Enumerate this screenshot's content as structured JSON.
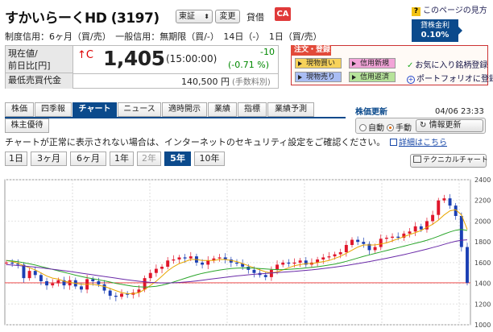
{
  "header": {
    "stock_title": "すかいらーくHD (3197)",
    "market": "東証",
    "change_label": "変更",
    "lending_label": "貸借",
    "ca_badge": "CA",
    "page_help": "このページの見方",
    "lending_rate_label": "貸株金利",
    "lending_rate_value": "0.10%",
    "credit_info": "制度信用：6ヶ月（買/売）　一般信用：無期限（買/-）　14日（-）　1日（買/売）"
  },
  "price": {
    "label_current": "現在値/",
    "label_prev": "前日比[円]",
    "label_turnover": "最低売買代金",
    "mark": "↑C",
    "value": "1,405",
    "time": "(15:00:00)",
    "change": "-10",
    "change_pct": "(-0.71 %)",
    "turnover": "140,500",
    "turnover_unit": "円",
    "fee_note": "(手数料別)",
    "color_down": "#008800"
  },
  "order": {
    "title": "注文・登録",
    "buy": "現物買い",
    "new_credit": "信用新規",
    "sell": "現物売り",
    "repay": "信用返済",
    "favorite": "お気に入り銘柄登録",
    "portfolio": "ポートフォリオに登録"
  },
  "tabs": [
    "株価",
    "四季報",
    "チャート",
    "ニュース",
    "適時開示",
    "業績",
    "指標",
    "業績予測"
  ],
  "tab_active": "チャート",
  "tab_row2": "株主優待",
  "update": {
    "title": "株価更新",
    "time": "04/06 23:33",
    "auto": "自動",
    "manual": "手動",
    "refresh": "情報更新"
  },
  "notice": "チャートが正常に表示されない場合は、インターネットのセキュリティ設定をご確認ください。",
  "details": "詳細はこちら",
  "periods": [
    "1日",
    "3ヶ月",
    "6ヶ月",
    "1年",
    "2年",
    "5年",
    "10年"
  ],
  "period_active": "5年",
  "period_disabled": "2年",
  "tech_chart": "テクニカルチャート",
  "chart_data": {
    "type": "line",
    "ylim": [
      1000,
      2400
    ],
    "y_ticks": [
      "2400",
      "2200",
      "2000",
      "1800",
      "1600",
      "1400",
      "1200",
      "1000"
    ],
    "reference_line": 1405,
    "x": [
      0,
      1,
      2,
      3,
      4,
      5,
      6,
      7,
      8,
      9,
      10,
      11,
      12,
      13,
      14,
      15,
      16,
      17,
      18,
      19,
      20,
      21,
      22,
      23,
      24,
      25,
      26,
      27,
      28,
      29,
      30,
      31,
      32,
      33,
      34,
      35,
      36,
      37,
      38,
      39,
      40,
      41,
      42,
      43,
      44,
      45,
      46,
      47,
      48,
      49,
      50,
      51,
      52,
      53,
      54,
      55,
      56,
      57,
      58,
      59,
      60,
      61,
      62,
      63,
      64,
      65,
      66,
      67,
      68,
      69,
      70,
      71,
      72,
      73,
      74,
      75,
      76,
      77,
      78,
      79,
      80
    ],
    "close": [
      1600,
      1590,
      1580,
      1450,
      1520,
      1480,
      1420,
      1380,
      1400,
      1430,
      1380,
      1430,
      1370,
      1340,
      1440,
      1420,
      1390,
      1330,
      1280,
      1270,
      1300,
      1290,
      1310,
      1340,
      1450,
      1500,
      1540,
      1560,
      1620,
      1630,
      1650,
      1640,
      1660,
      1600,
      1580,
      1620,
      1640,
      1650,
      1630,
      1600,
      1590,
      1560,
      1530,
      1500,
      1480,
      1460,
      1530,
      1580,
      1600,
      1590,
      1600,
      1620,
      1580,
      1600,
      1630,
      1650,
      1660,
      1680,
      1700,
      1770,
      1820,
      1800,
      1780,
      1720,
      1750,
      1830,
      1840,
      1850,
      1840,
      1880,
      1900,
      1950,
      1920,
      2000,
      2060,
      2200,
      2220,
      2150,
      2050,
      1750,
      1405
    ],
    "ma_short": [
      1620,
      1610,
      1595,
      1570,
      1550,
      1530,
      1500,
      1470,
      1450,
      1440,
      1420,
      1410,
      1400,
      1390,
      1390,
      1390,
      1380,
      1370,
      1350,
      1330,
      1310,
      1300,
      1300,
      1310,
      1340,
      1380,
      1420,
      1470,
      1520,
      1560,
      1590,
      1610,
      1630,
      1630,
      1620,
      1620,
      1620,
      1630,
      1630,
      1620,
      1610,
      1590,
      1570,
      1550,
      1530,
      1510,
      1500,
      1510,
      1530,
      1550,
      1570,
      1580,
      1590,
      1590,
      1600,
      1610,
      1620,
      1640,
      1660,
      1690,
      1720,
      1750,
      1770,
      1770,
      1770,
      1780,
      1790,
      1810,
      1830,
      1850,
      1870,
      1890,
      1910,
      1940,
      1970,
      2010,
      2060,
      2100,
      2110,
      2060,
      1920
    ],
    "ma_mid": [
      1620,
      1615,
      1608,
      1598,
      1588,
      1576,
      1562,
      1548,
      1534,
      1520,
      1506,
      1492,
      1478,
      1466,
      1454,
      1444,
      1434,
      1424,
      1412,
      1400,
      1390,
      1380,
      1372,
      1366,
      1364,
      1366,
      1372,
      1382,
      1396,
      1412,
      1430,
      1448,
      1466,
      1482,
      1496,
      1508,
      1518,
      1528,
      1536,
      1542,
      1546,
      1548,
      1548,
      1546,
      1542,
      1538,
      1534,
      1532,
      1532,
      1534,
      1538,
      1542,
      1548,
      1554,
      1560,
      1568,
      1576,
      1586,
      1598,
      1612,
      1628,
      1644,
      1660,
      1674,
      1688,
      1702,
      1716,
      1730,
      1744,
      1758,
      1772,
      1786,
      1800,
      1816,
      1834,
      1854,
      1876,
      1896,
      1912,
      1920,
      1910
    ],
    "ma_long": [
      1580,
      1576,
      1572,
      1567,
      1562,
      1556,
      1550,
      1543,
      1536,
      1529,
      1522,
      1514,
      1506,
      1498,
      1490,
      1482,
      1474,
      1466,
      1458,
      1450,
      1442,
      1434,
      1427,
      1420,
      1414,
      1409,
      1406,
      1404,
      1404,
      1405,
      1408,
      1412,
      1417,
      1423,
      1430,
      1437,
      1444,
      1451,
      1458,
      1465,
      1471,
      1477,
      1482,
      1487,
      1491,
      1495,
      1499,
      1503,
      1507,
      1511,
      1515,
      1520,
      1525,
      1530,
      1536,
      1542,
      1549,
      1556,
      1564,
      1572,
      1581,
      1590,
      1600,
      1610,
      1620,
      1631,
      1642,
      1653,
      1665,
      1677,
      1690,
      1703,
      1716,
      1730,
      1745,
      1760,
      1776,
      1792,
      1806,
      1816,
      1820
    ]
  }
}
